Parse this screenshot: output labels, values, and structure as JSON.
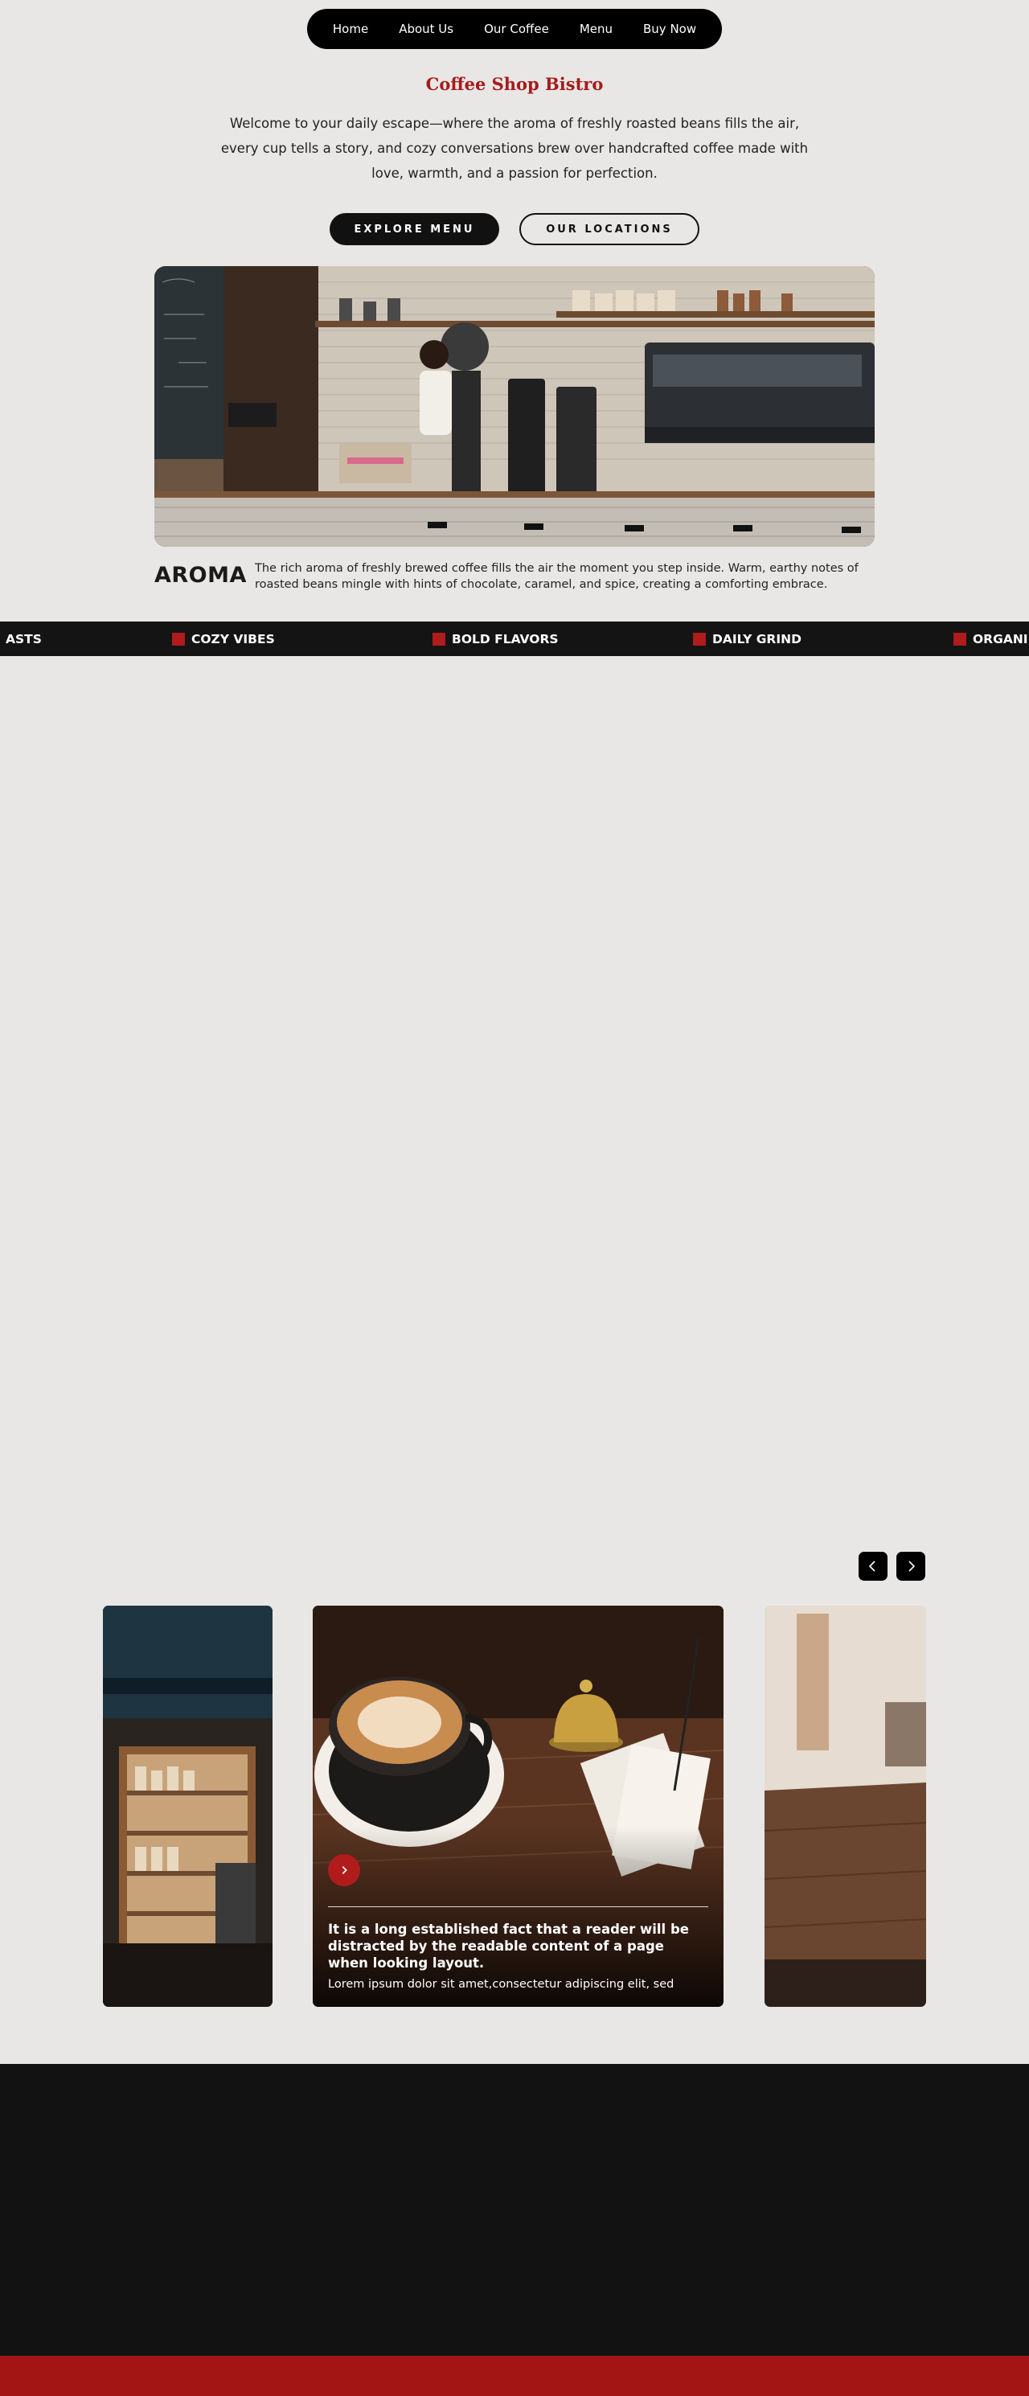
{
  "nav": {
    "items": [
      "Home",
      "About Us",
      "Our Coffee",
      "Menu",
      "Buy Now"
    ]
  },
  "hero": {
    "title": "Coffee Shop Bistro",
    "intro": "Welcome to your daily escape—where the aroma of freshly roasted beans fills the air, every cup tells a story, and cozy conversations brew over handcrafted coffee made with love, warmth, and a passion for perfection.",
    "btn_menu": "EXPLORE MENU",
    "btn_locations": "OUR LOCATIONS"
  },
  "aroma": {
    "heading": "AROMA",
    "text": "The rich aroma of freshly brewed coffee fills the air the moment you step inside. Warm, earthy notes of roasted beans mingle with hints of chocolate, caramel, and spice, creating a comforting embrace."
  },
  "marquee": {
    "items": [
      "ASTS",
      "COZY VIBES",
      "BOLD FLAVORS",
      "DAILY GRIND",
      "ORGANI"
    ]
  },
  "slider": {
    "card_title": "It is a long established fact that a reader will be distracted by the readable content of a page when looking layout.",
    "card_sub": "Lorem ipsum dolor sit amet,consectetur adipiscing elit, sed"
  },
  "colors": {
    "accent": "#a51c1c",
    "dark": "#121212",
    "background": "#e8e7e5"
  },
  "icons": {
    "prev": "chevron-left-icon",
    "next": "chevron-right-icon",
    "play": "chevron-right-icon"
  }
}
